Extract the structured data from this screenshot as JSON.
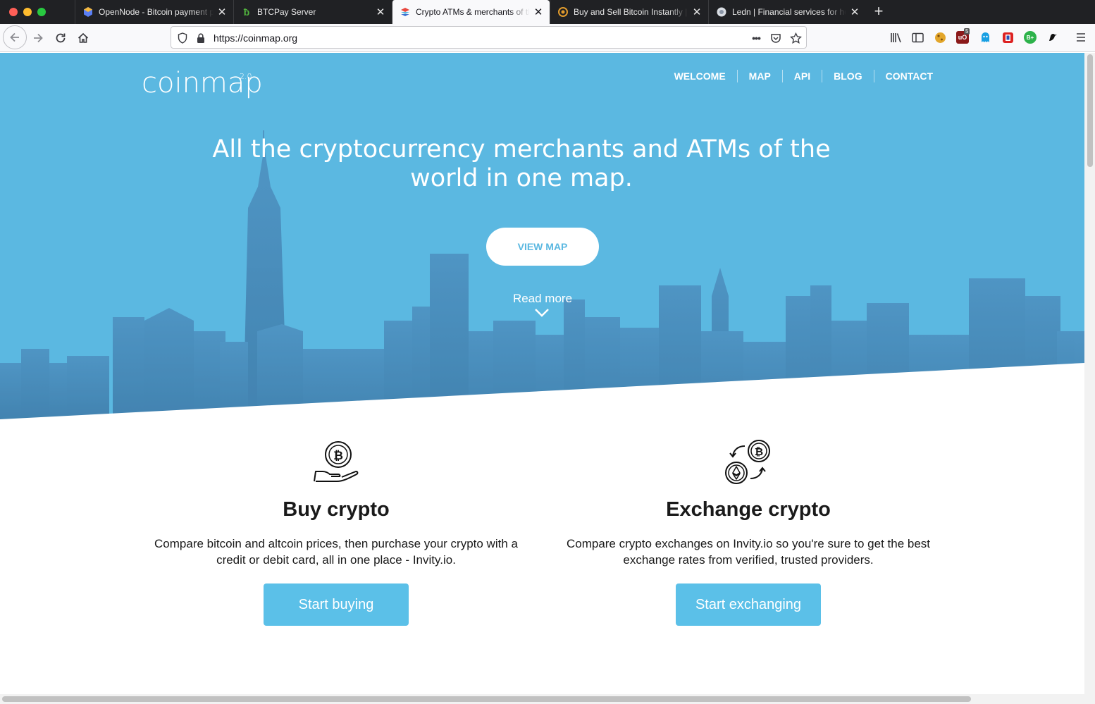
{
  "browser": {
    "tabs": [
      {
        "title": "OpenNode - Bitcoin payment pr",
        "favicon": "opennode-icon",
        "active": false
      },
      {
        "title": "BTCPay Server",
        "favicon": "btcpay-icon",
        "active": false
      },
      {
        "title": "Crypto ATMs & merchants of th",
        "favicon": "coinmap-icon",
        "active": true
      },
      {
        "title": "Buy and Sell Bitcoin Instantly | E",
        "favicon": "exchange-icon",
        "active": false
      },
      {
        "title": "Ledn | Financial services for hol",
        "favicon": "ledn-icon",
        "active": false
      }
    ],
    "url": "https://coinmap.org",
    "ublock_badge": "5"
  },
  "site": {
    "logo": "coinmap",
    "logo_version": "2.0",
    "nav": [
      "WELCOME",
      "MAP",
      "API",
      "BLOG",
      "CONTACT"
    ],
    "headline": "All the cryptocurrency merchants and ATMs of the world in one map.",
    "view_map_label": "VIEW MAP",
    "read_more_label": "Read more",
    "accent_color": "#5bb8e1"
  },
  "features": [
    {
      "icon": "bitcoin-hand-icon",
      "title": "Buy crypto",
      "description": "Compare bitcoin and altcoin prices, then purchase your crypto with a credit or debit card, all in one place - Invity.io.",
      "button_label": "Start buying"
    },
    {
      "icon": "crypto-exchange-icon",
      "title": "Exchange crypto",
      "description": "Compare crypto exchanges on Invity.io so you're sure to get the best exchange rates from verified, trusted providers.",
      "button_label": "Start exchanging"
    }
  ]
}
